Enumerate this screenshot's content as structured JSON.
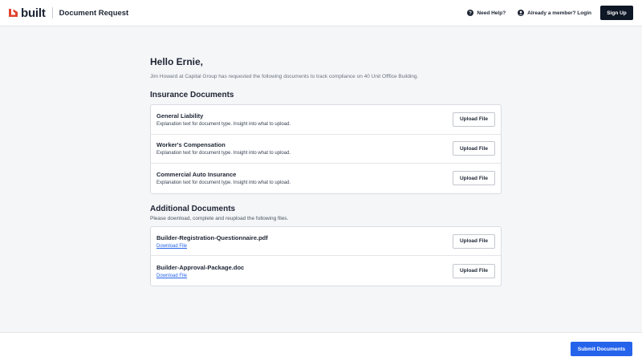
{
  "header": {
    "logo_text": "built",
    "logo_icon": "built-logo-mark",
    "app_title": "Document Request",
    "help_icon": "question-circle-icon",
    "help_label": "Need Help?",
    "login_icon": "user-circle-icon",
    "login_label": "Already a member? Login",
    "signup_label": "Sign Up"
  },
  "main": {
    "greeting": "Hello Ernie,",
    "intro": "Jim Howard at Capital Group has requested the following documents to track compliance on 40 Unit Offfice Building.",
    "insurance": {
      "title": "Insurance Documents",
      "items": [
        {
          "title": "General Liability",
          "description": "Explanation text for document type. Insight into what to upload.",
          "button_label": "Upload File"
        },
        {
          "title": "Worker's Compensation",
          "description": "Explanation text for document type. Insight into what to upload.",
          "button_label": "Upload File"
        },
        {
          "title": "Commercial Auto Insurance",
          "description": "Explanation text for document type. Insight into what to upload.",
          "button_label": "Upload File"
        }
      ]
    },
    "additional": {
      "title": "Additional Documents",
      "subtitle": "Please download, complete and reupload the following files.",
      "items": [
        {
          "title": "Builder-Registration-Questionnaire.pdf",
          "link_label": "Download File",
          "button_label": "Upload File"
        },
        {
          "title": "Builder-Approval-Package.doc",
          "link_label": "Download File",
          "button_label": "Upload File"
        }
      ]
    }
  },
  "footer": {
    "submit_label": "Submit Documents"
  },
  "colors": {
    "brand_red": "#e0452f",
    "navy": "#0d1726",
    "accent_blue": "#2563eb",
    "page_bg": "#f5f6f8"
  }
}
